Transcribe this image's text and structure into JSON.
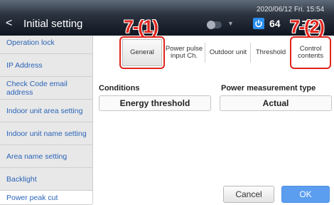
{
  "header": {
    "back_symbol": "<",
    "title": "Initial setting",
    "datetime": "2020/06/12 Fri. 15:54",
    "power_count": "64",
    "icons": [
      "back-chevron-icon",
      "toggle-switch-icon",
      "dropdown-arrow-icon",
      "power-icon",
      "menu-bars-icon"
    ]
  },
  "callouts": {
    "left": "7-(1)",
    "right": "7-(2)"
  },
  "sidebar": {
    "items": [
      {
        "label": "Operation lock"
      },
      {
        "label": "IP Address"
      },
      {
        "label": "Check Code email address"
      },
      {
        "label": "Indoor unit area setting"
      },
      {
        "label": "Indoor unit name setting"
      },
      {
        "label": "Area name setting"
      },
      {
        "label": "Backlight"
      },
      {
        "label": "Power peak cut"
      }
    ],
    "active_index": 7
  },
  "tabs": {
    "general": "General",
    "power_pulse": "Power pulse input Ch.",
    "outdoor_unit": "Outdoor unit",
    "threshold": "Threshold",
    "control_contents": "Control contents",
    "selected": "General"
  },
  "form": {
    "conditions_label": "Conditions",
    "conditions_value": "Energy threshold",
    "power_type_label": "Power measurement type",
    "power_type_value": "Actual"
  },
  "buttons": {
    "cancel": "Cancel",
    "ok": "OK"
  },
  "colors": {
    "accent_red": "#e0241b",
    "link_blue": "#2a63b8",
    "ok_blue": "#5b9ef0",
    "power_blue": "#2a8ff0"
  }
}
